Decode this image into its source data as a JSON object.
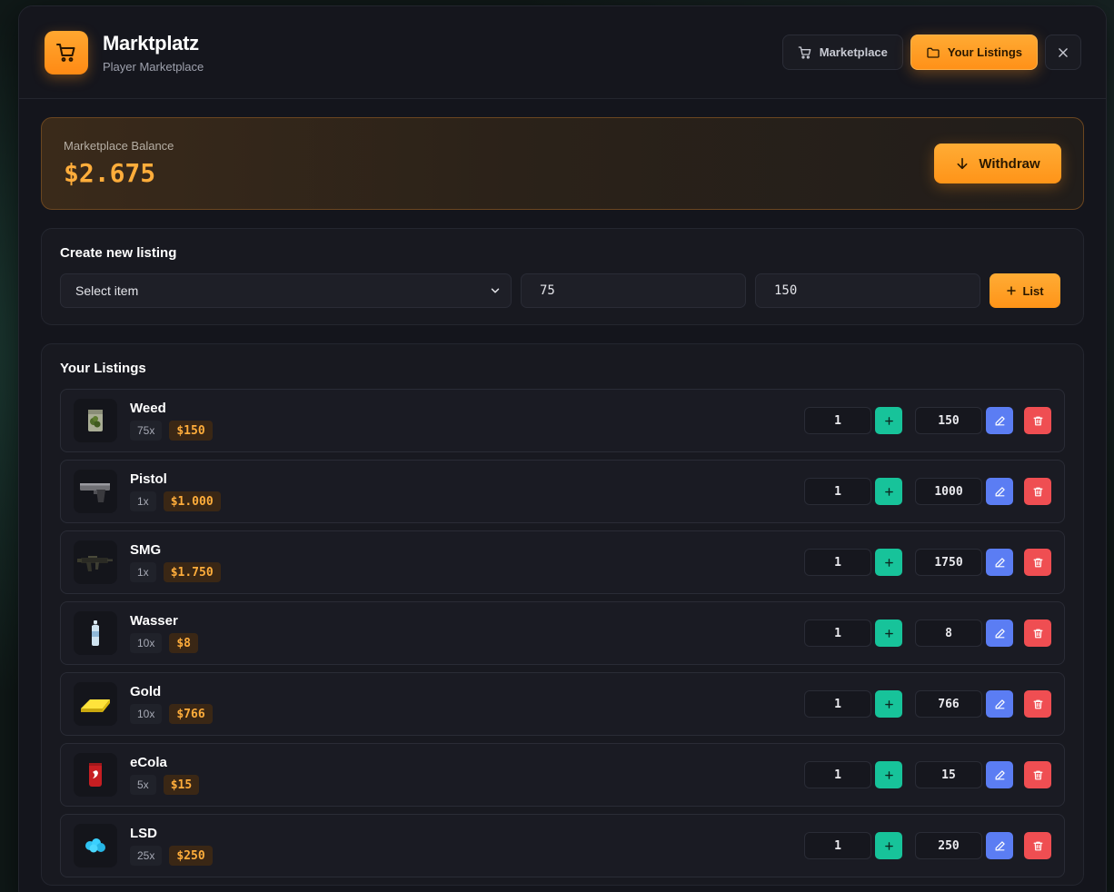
{
  "header": {
    "title": "Marktplatz",
    "subtitle": "Player Marketplace",
    "nav": {
      "marketplace_label": "Marketplace",
      "your_listings_label": "Your Listings"
    },
    "accent_color": "#ff9a22"
  },
  "balance": {
    "label": "Marketplace Balance",
    "value": "$2.675",
    "withdraw_label": "Withdraw"
  },
  "create_listing": {
    "title": "Create new listing",
    "select_value": "Select item",
    "amount_value": "75",
    "price_value": "150",
    "list_label": "List"
  },
  "listings": {
    "title": "Your Listings",
    "items": [
      {
        "name": "Weed",
        "quantity": "75x",
        "price": "$150",
        "amount_input": "1",
        "price_input": "150",
        "icon": "weed-bag-icon"
      },
      {
        "name": "Pistol",
        "quantity": "1x",
        "price": "$1.000",
        "amount_input": "1",
        "price_input": "1000",
        "icon": "pistol-icon"
      },
      {
        "name": "SMG",
        "quantity": "1x",
        "price": "$1.750",
        "amount_input": "1",
        "price_input": "1750",
        "icon": "smg-icon"
      },
      {
        "name": "Wasser",
        "quantity": "10x",
        "price": "$8",
        "amount_input": "1",
        "price_input": "8",
        "icon": "water-bottle-icon"
      },
      {
        "name": "Gold",
        "quantity": "10x",
        "price": "$766",
        "amount_input": "1",
        "price_input": "766",
        "icon": "gold-bar-icon"
      },
      {
        "name": "eCola",
        "quantity": "5x",
        "price": "$15",
        "amount_input": "1",
        "price_input": "15",
        "icon": "cola-can-icon"
      },
      {
        "name": "LSD",
        "quantity": "25x",
        "price": "$250",
        "amount_input": "1",
        "price_input": "250",
        "icon": "lsd-icon"
      }
    ]
  },
  "colors": {
    "add": "#17c39a",
    "edit": "#5b7df3",
    "delete": "#ef4e52"
  }
}
